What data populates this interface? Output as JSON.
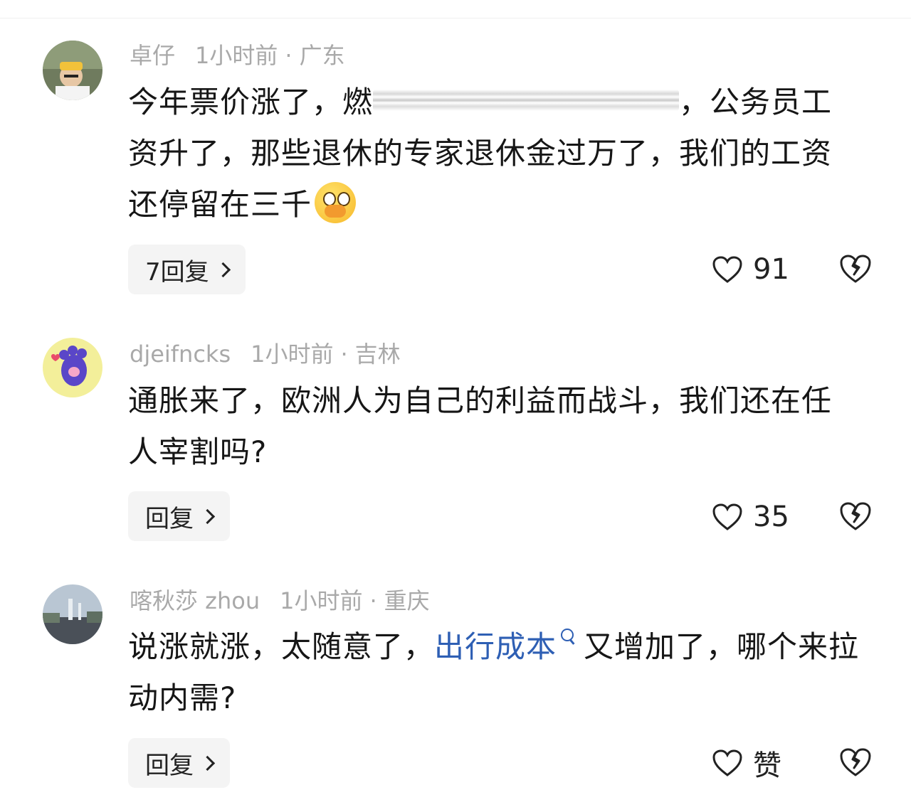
{
  "comments": [
    {
      "user": "卓仔",
      "time": "1小时前",
      "location": "广东",
      "text_a": "今年票价涨了，燃",
      "text_b": "，公务员工资升了，那些退休的专家退休金过万了，我们的工资还停留在三千",
      "reply_label": "7回复",
      "likes": "91"
    },
    {
      "user": "djeifncks",
      "time": "1小时前",
      "location": "吉林",
      "text": "通胀来了，欧洲人为自己的利益而战斗，我们还在任人宰割吗?",
      "reply_label": "回复",
      "likes": "35"
    },
    {
      "user": "喀秋莎 zhou",
      "time": "1小时前",
      "location": "重庆",
      "text_a": "说涨就涨，太随意了，",
      "topic": "出行成本",
      "text_b": "又增加了，哪个来拉动内需?",
      "reply_label": "回复",
      "likes": "赞"
    }
  ],
  "separator": "·",
  "colors": {
    "link": "#2e5fb4",
    "meta": "#a9a9a9",
    "button_bg": "#f4f4f4"
  }
}
